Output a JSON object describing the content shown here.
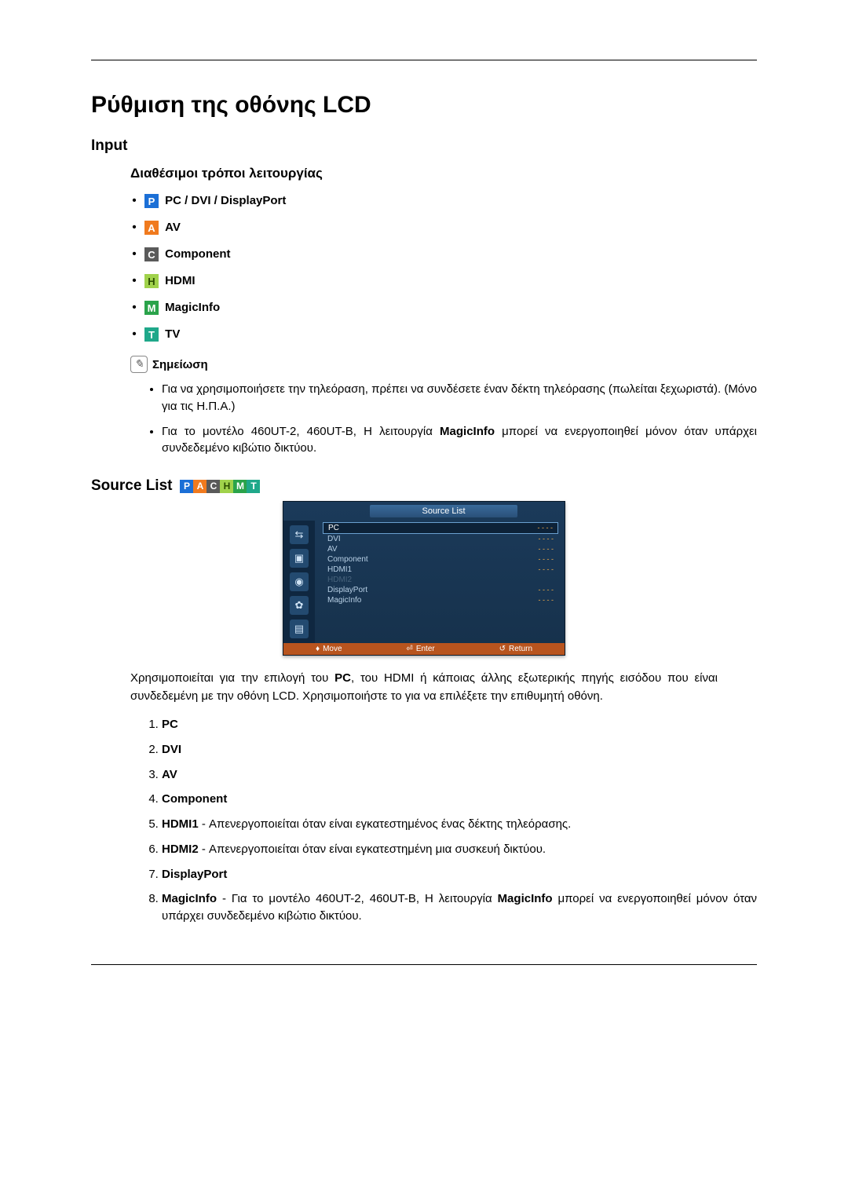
{
  "title": "Ρύθμιση της οθόνης LCD",
  "section_input": "Input",
  "modes_heading": "Διαθέσιμοι τρόποι λειτουργίας",
  "modes": [
    {
      "badge": "P",
      "cls": "badge-P",
      "label": "PC / DVI / DisplayPort"
    },
    {
      "badge": "A",
      "cls": "badge-A",
      "label": "AV"
    },
    {
      "badge": "C",
      "cls": "badge-C",
      "label": "Component"
    },
    {
      "badge": "H",
      "cls": "badge-H",
      "label": "HDMI"
    },
    {
      "badge": "M",
      "cls": "badge-M",
      "label": "MagicInfo"
    },
    {
      "badge": "T",
      "cls": "badge-T",
      "label": "TV"
    }
  ],
  "note_label": "Σημείωση",
  "notes": [
    "Για να χρησιμοποιήσετε την τηλεόραση, πρέπει να συνδέσετε έναν δέκτη τηλεόρασης (πωλείται ξεχωριστά). (Μόνο για τις Η.Π.Α.)",
    "Για το μοντέλο 460UT-2, 460UT-B, Η λειτουργία MagicInfo μπορεί να ενεργοποιηθεί μόνον όταν υπάρχει συνδεδεμένο κιβώτιο δικτύου."
  ],
  "source_list_heading": "Source List",
  "source_badges": [
    "P",
    "A",
    "C",
    "H",
    "M",
    "T"
  ],
  "source_badge_cls": [
    "badge-P",
    "badge-A",
    "badge-C",
    "badge-H",
    "badge-M",
    "badge-T"
  ],
  "osd": {
    "title": "Source List",
    "rows": [
      {
        "name": "PC",
        "status": "- - - -",
        "sel": true
      },
      {
        "name": "DVI",
        "status": "- - - -"
      },
      {
        "name": "AV",
        "status": "- - - -"
      },
      {
        "name": "Component",
        "status": "- - - -"
      },
      {
        "name": "HDMI1",
        "status": "- - - -"
      },
      {
        "name": "HDMI2",
        "status": "",
        "disabled": true
      },
      {
        "name": "DisplayPort",
        "status": "- - - -"
      },
      {
        "name": "MagicInfo",
        "status": "- - - -"
      }
    ],
    "footer": {
      "move": "Move",
      "enter": "Enter",
      "return": "Return"
    }
  },
  "paragraph_pre": "Χρησιμοποιείται για την επιλογή του ",
  "paragraph_bold": "PC",
  "paragraph_post": ", του HDMI ή κάποιας άλλης εξωτερικής πηγής εισόδου που είναι συνδεδεμένη με την οθόνη LCD. Χρησιμοποιήστε το για να επιλέξετε την επιθυμητή οθόνη.",
  "ordered": [
    {
      "label": "PC",
      "text": ""
    },
    {
      "label": "DVI",
      "text": ""
    },
    {
      "label": "AV",
      "text": ""
    },
    {
      "label": "Component",
      "text": ""
    },
    {
      "label": "HDMI1",
      "text": " - Απενεργοποιείται όταν είναι εγκατεστημένος ένας δέκτης τηλεόρασης."
    },
    {
      "label": "HDMI2",
      "text": " - Απενεργοποιείται όταν είναι εγκατεστημένη μια συσκευή δικτύου."
    },
    {
      "label": "DisplayPort",
      "text": ""
    },
    {
      "label": "MagicInfo",
      "text": " - Για το μοντέλο 460UT-2, 460UT-B, Η λειτουργία MagicInfo μπορεί να ενεργοποιηθεί μόνον όταν υπάρχει συνδεδεμένο κιβώτιο δικτύου."
    }
  ]
}
